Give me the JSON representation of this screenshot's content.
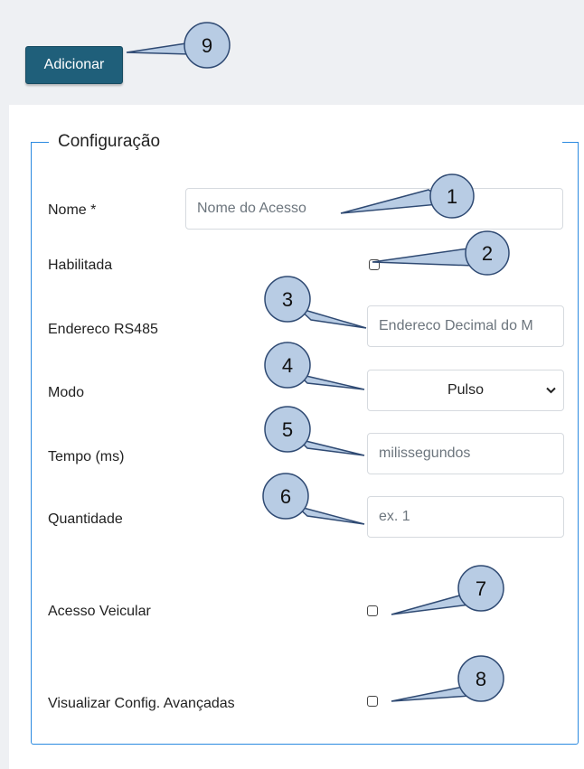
{
  "toolbar": {
    "add_label": "Adicionar"
  },
  "fieldset": {
    "legend": "Configuração"
  },
  "form": {
    "nome": {
      "label": "Nome *",
      "placeholder": "Nome do Acesso"
    },
    "habilitada": {
      "label": "Habilitada",
      "checked": false
    },
    "endereco": {
      "label": "Endereco RS485",
      "placeholder": "Endereco Decimal do M"
    },
    "modo": {
      "label": "Modo",
      "value": "Pulso"
    },
    "tempo": {
      "label": "Tempo (ms)",
      "placeholder": "milissegundos"
    },
    "quantidade": {
      "label": "Quantidade",
      "placeholder": "ex. 1"
    },
    "acesso_veicular": {
      "label": "Acesso Veicular",
      "checked": false
    },
    "config_avancadas": {
      "label": "Visualizar Config. Avançadas",
      "checked": false
    }
  },
  "callouts": [
    "1",
    "2",
    "3",
    "4",
    "5",
    "6",
    "7",
    "8",
    "9"
  ],
  "colors": {
    "accent": "#2b8ae0",
    "button": "#1f5f7a",
    "callout_fill": "#b8cce4",
    "callout_stroke": "#2f4a73"
  }
}
